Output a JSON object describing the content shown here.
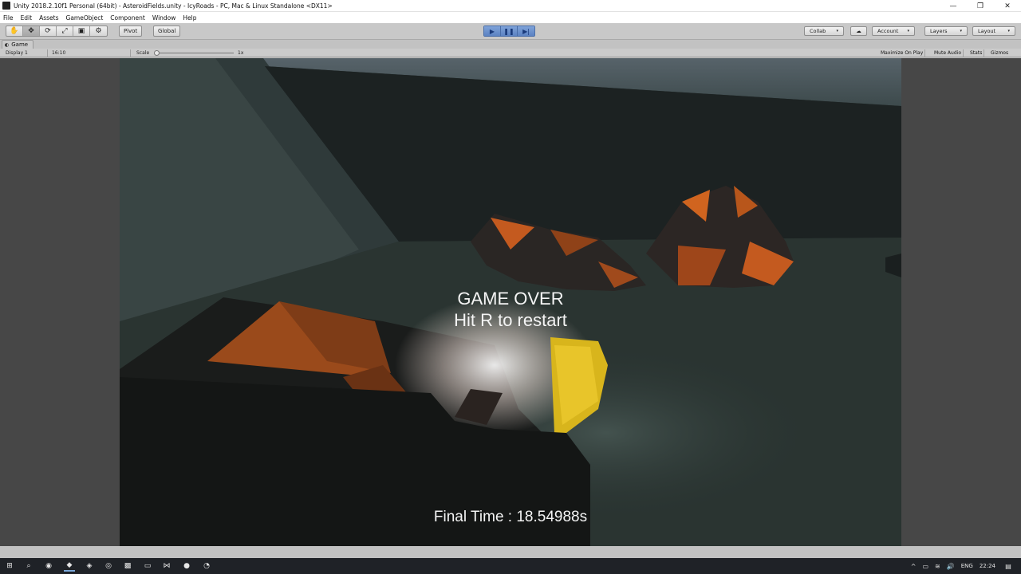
{
  "window": {
    "title": "Unity 2018.2.10f1 Personal (64bit) - AsteroidFields.unity - IcyRoads - PC, Mac & Linux Standalone <DX11>",
    "minimize": "—",
    "restore": "❐",
    "close": "✕"
  },
  "menu": [
    "File",
    "Edit",
    "Assets",
    "GameObject",
    "Component",
    "Window",
    "Help"
  ],
  "toolbar": {
    "tools": [
      "✋",
      "✥",
      "⟳",
      "⤢",
      "▣",
      "⚙"
    ],
    "pivot": "Pivot",
    "global": "Global",
    "play": "▶",
    "pause": "❚❚",
    "step": "▶|",
    "collab": "Collab",
    "cloud": "☁",
    "account": "Account",
    "layers": "Layers",
    "layout": "Layout",
    "caret": "▾"
  },
  "game_tab": {
    "icon": "◐",
    "label": "Game"
  },
  "game_toolbar": {
    "display": "Display 1",
    "aspect": "16:10",
    "scale_label": "Scale",
    "scale_value": "1x",
    "maximize": "Maximize On Play",
    "mute": "Mute Audio",
    "stats": "Stats",
    "gizmos": "Gizmos"
  },
  "game_overlay": {
    "line1": "GAME OVER",
    "line2": "Hit R to restart",
    "final_time": "Final Time : 18.54988s"
  },
  "taskbar": {
    "icons": [
      "windows-start",
      "search",
      "steam",
      "unity",
      "app",
      "chrome",
      "paint",
      "file-explorer",
      "visual-studio",
      "spotify",
      "clock-app"
    ],
    "glyphs": [
      "⊞",
      "⌕",
      "◉",
      "◆",
      "◈",
      "◎",
      "▩",
      "▭",
      "⋈",
      "●",
      "◔"
    ],
    "tray_up": "^",
    "tray_wifi": "≋",
    "tray_volume": "🔊",
    "tray_battery": "▭",
    "lang": "ENG",
    "time": "22:24",
    "notification": "▤"
  }
}
